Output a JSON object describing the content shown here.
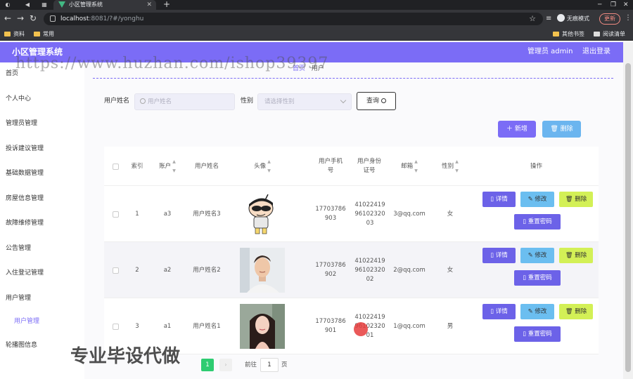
{
  "browser": {
    "tab_title": "小区管理系统",
    "url_host": "localhost",
    "url_rest": ":8081/?#/yonghu",
    "incognito_label": "无痕模式",
    "update_label": "更新",
    "bookmarks": [
      "资料",
      "常用"
    ],
    "bookmarks_right": [
      "其他书签",
      "阅读清单"
    ]
  },
  "header": {
    "title": "小区管理系统",
    "admin": "管理员 admin",
    "logout": "退出登录"
  },
  "sidebar": {
    "items": [
      "首页",
      "个人中心",
      "管理员管理",
      "投诉建议管理",
      "基础数据管理",
      "房屋信息管理",
      "故障维修管理",
      "公告管理",
      "入住登记管理",
      "用户管理"
    ],
    "sub_item": "用户管理",
    "last_item": "轮播图信息"
  },
  "breadcrumb": {
    "home": "首页",
    "current": "用户"
  },
  "search": {
    "name_label": "用户姓名",
    "name_placeholder": "用户姓名",
    "gender_label": "性别",
    "gender_placeholder": "请选择性别",
    "query_button": "查询"
  },
  "actions": {
    "add": "新增",
    "delete": "删除"
  },
  "table": {
    "headers": {
      "index": "索引",
      "account": "账户",
      "name": "用户姓名",
      "avatar": "头像",
      "phone": "用户手机号",
      "idcard": "用户身份证号",
      "email": "邮箱",
      "gender": "性别",
      "ops": "操作"
    },
    "rows": [
      {
        "index": "1",
        "account": "a3",
        "name": "用户姓名3",
        "phone": "17703786903",
        "idcard": "410224199610232003",
        "email": "3@qq.com",
        "gender": "女"
      },
      {
        "index": "2",
        "account": "a2",
        "name": "用户姓名2",
        "phone": "17703786902",
        "idcard": "410224199610232002",
        "email": "2@qq.com",
        "gender": "女"
      },
      {
        "index": "3",
        "account": "a1",
        "name": "用户姓名1",
        "phone": "17703786901",
        "idcard": "410224199610232001",
        "email": "1@qq.com",
        "gender": "男"
      }
    ],
    "row_actions": {
      "detail": "详情",
      "edit": "修改",
      "delete": "删除",
      "reset": "重置密码"
    }
  },
  "pager": {
    "current_page": "1",
    "goto_label": "前往",
    "goto_value": "1",
    "page_suffix": "页"
  },
  "overlay": {
    "watermark_url": "https://www.huzhan.com/ishop39397",
    "watermark_cn": "专业毕设代做"
  },
  "colors": {
    "accent": "#7b6cf6",
    "add_button": "#7b6cf6",
    "delete_button": "#6bb5ef",
    "row_delete": "#d3f056",
    "pager_active": "#2ecc71"
  }
}
